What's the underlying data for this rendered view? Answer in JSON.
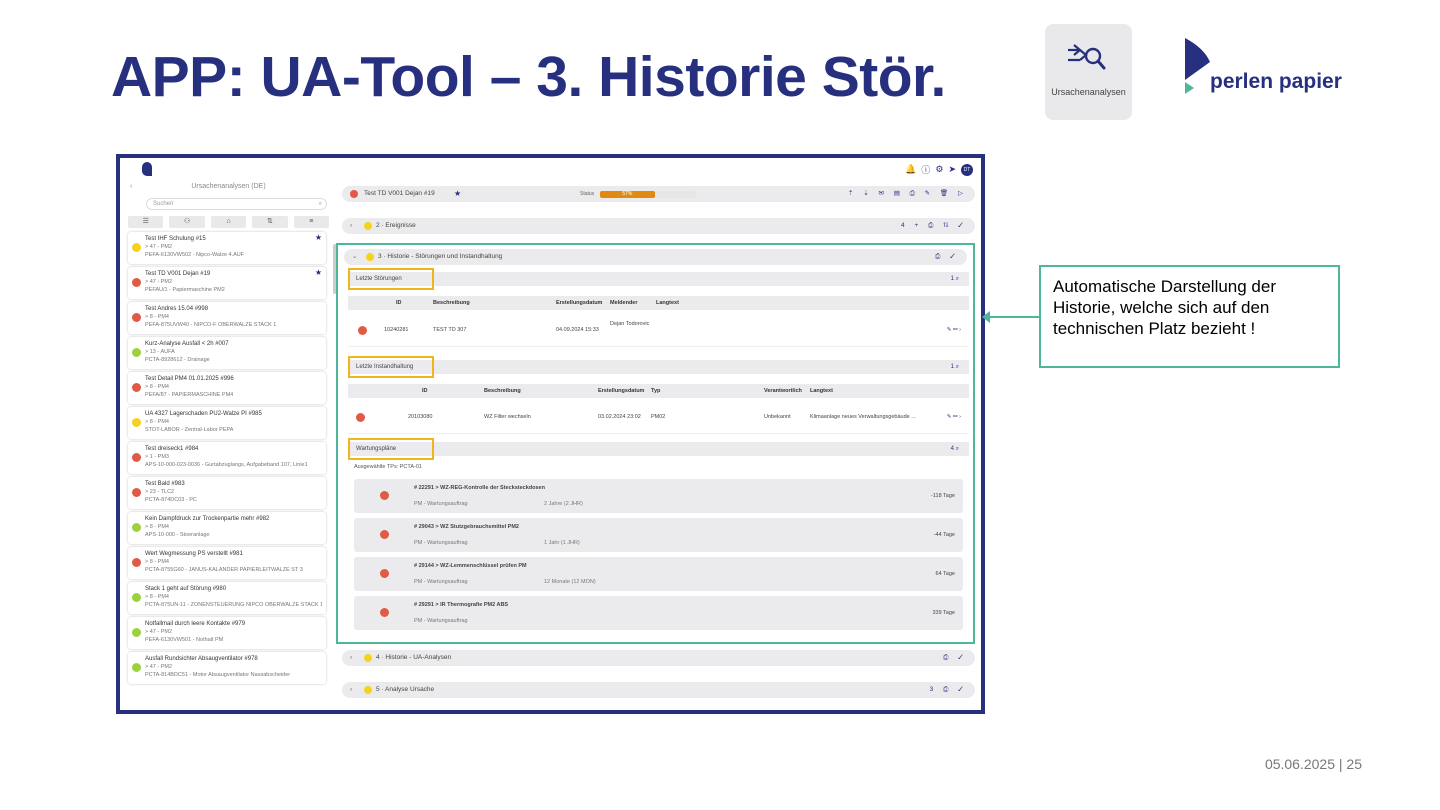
{
  "slide": {
    "title": "APP: UA-Tool – 3. Historie Stör.",
    "tool_badge_label": "Ursachenanalysen",
    "logo_text": "perlen papier",
    "footer": "05.06.2025 | 25"
  },
  "callout": {
    "text": "Automatische Darstellung der Historie, welche sich auf den technischen Platz bezieht !"
  },
  "colors": {
    "primary": "#27307e",
    "accent": "#4fb59b",
    "red": "#e15a46",
    "yellow": "#f5d21e",
    "green": "#9bd23c",
    "orange": "#e08a12"
  },
  "app": {
    "sidebar": {
      "title": "Ursachenanalysen (DE)",
      "search_placeholder": "Suchen",
      "items": [
        {
          "title": "Test IHF Schulung  #15",
          "line1": "> 47 - PM2",
          "line2": "PEFA-6130VW502 - Nipco-Walze 4.AUF",
          "status": "yellow",
          "starred": true
        },
        {
          "title": "Test TD V001 Dejan  #19",
          "line1": "> 47 - PM2",
          "line2": "PEFAU/1 - Papiermaschine PM2",
          "status": "red",
          "starred": true
        },
        {
          "title": "Test Andres 15.04  #998",
          "line1": "> 8 - PM4",
          "line2": "PEFA-875UVW40 - NIPCO-F OBERWALZE STACK 1",
          "status": "red",
          "starred": false
        },
        {
          "title": "Kurz-Analyse Ausfall < 2h  #007",
          "line1": "> 13 - AUFA",
          "line2": "PCTA-8928612 - Drainage",
          "status": "green",
          "starred": false
        },
        {
          "title": "Test Detail PM4 01.01.2025  #996",
          "line1": "> 8 - PM4",
          "line2": "PEFA/87 - PAPIERMASCHINE PM4",
          "status": "red",
          "starred": false
        },
        {
          "title": "UA 4327 Lagerschaden PU2-Walze PI  #985",
          "line1": "> 8 - PM4",
          "line2": "STOT-LABOR - Zentral-Labor PEPA",
          "status": "yellow",
          "starred": false
        },
        {
          "title": "Test dreiseck1  #984",
          "line1": "> 1 - PM3",
          "line2": "APS-10-000-023-0036 - Gurtabzuglangs, Aufgabeband 107, Linie1",
          "status": "red",
          "starred": false
        },
        {
          "title": "Test Bald  #983",
          "line1": "> 23 - TLC2",
          "line2": "PCTA-874DC03 - PC",
          "status": "red",
          "starred": false
        },
        {
          "title": "Kein Dampfdruck zur Trockenpartie mehr  #982",
          "line1": "> 8 - PM4",
          "line2": "APS-10-000 - Stoeranlage",
          "status": "green",
          "starred": false
        },
        {
          "title": "Wert Wegmessung PS verstellt  #981",
          "line1": "> 8 - PM4",
          "line2": "PCTA-8755G60 - JANUS-KALANDER PAPIERLEITWALZE ST 3",
          "status": "red",
          "starred": false
        },
        {
          "title": "Stack 1 geht auf Störung  #980",
          "line1": "> 8 - PM4",
          "line2": "PCTA-875UN-11 - ZONENSTEUERUNG NIPCO OBERWALZE STACK 1",
          "status": "green",
          "starred": false
        },
        {
          "title": "Notfallmail durch leere Kontakte  #979",
          "line1": "> 47 - PM2",
          "line2": "PEFA-6130VW501 - Nothalt PM",
          "status": "green",
          "starred": false
        },
        {
          "title": "Ausfall Rundsichter Absaugventilator  #978",
          "line1": "> 47 - PM2",
          "line2": "PCTA-814BDC51 - Motor Absaugventilator Nassabscheider",
          "status": "green",
          "starred": false
        }
      ]
    },
    "header": {
      "title": "Test TD V001 Dejan  #19",
      "status_label": "Status",
      "progress_percent": 57,
      "progress_text": "57%"
    },
    "sections": {
      "s2": {
        "label": "2 · Ereignisse",
        "count": "4"
      },
      "s3": {
        "label": "3 · Historie - Störungen und Instandhaltung"
      },
      "s4": {
        "label": "4 · Historie - UA-Analysen"
      },
      "s5": {
        "label": "5 · Analyse Ursache",
        "count": "3"
      }
    },
    "stoerungen": {
      "label": "Letzte Störungen",
      "count": "1",
      "columns": [
        "ID",
        "Beschreibung",
        "Erstellungsdatum",
        "Meldender",
        "Langtext"
      ],
      "rows": [
        {
          "id": "10240281",
          "desc": "TEST TD 307",
          "date": "04.09.2024 15:33",
          "reporter": "Dejan Todorovic"
        }
      ]
    },
    "instandhaltung": {
      "label": "Letzte Instandhaltung",
      "count": "1",
      "columns": [
        "ID",
        "Beschreibung",
        "Erstellungsdatum",
        "Typ",
        "Verantwortlich",
        "Langtext"
      ],
      "rows": [
        {
          "id": "20103080",
          "desc": "WZ Filter wechseln",
          "date": "03.02.2024 23:02",
          "type": "PM02",
          "resp": "Unbekannt",
          "long": "Klimaanlage neues Verwaltungsgebäude ..."
        }
      ]
    },
    "wartung": {
      "label": "Wartungspläne",
      "count": "4",
      "selected": "Ausgewählte TPs: PCTA-01",
      "items": [
        {
          "title": "#  22291  >  WZ-REG-Kontrolle der Stecksteckdosen",
          "sub": "PM - Wartungsauftrag",
          "interval": "2 Jahre (2 JHR)",
          "due": "-118 Tage"
        },
        {
          "title": "#  29043  >  WZ Stutzgebrauchsmittel PM2",
          "sub": "PM - Wartungsauftrag",
          "interval": "1 Jahr (1 JHR)",
          "due": "-44 Tage"
        },
        {
          "title": "#  29144  >  WZ-Lemmenschlüssel prüfen PM",
          "sub": "PM - Wartungsauftrag",
          "interval": "12 Monate (12 MON)",
          "due": "64 Tage"
        },
        {
          "title": "#  29291  >  IR Thermografie PM2 ABS",
          "sub": "PM - Wartungsauftrag",
          "interval": "",
          "due": "339 Tage"
        }
      ]
    }
  }
}
